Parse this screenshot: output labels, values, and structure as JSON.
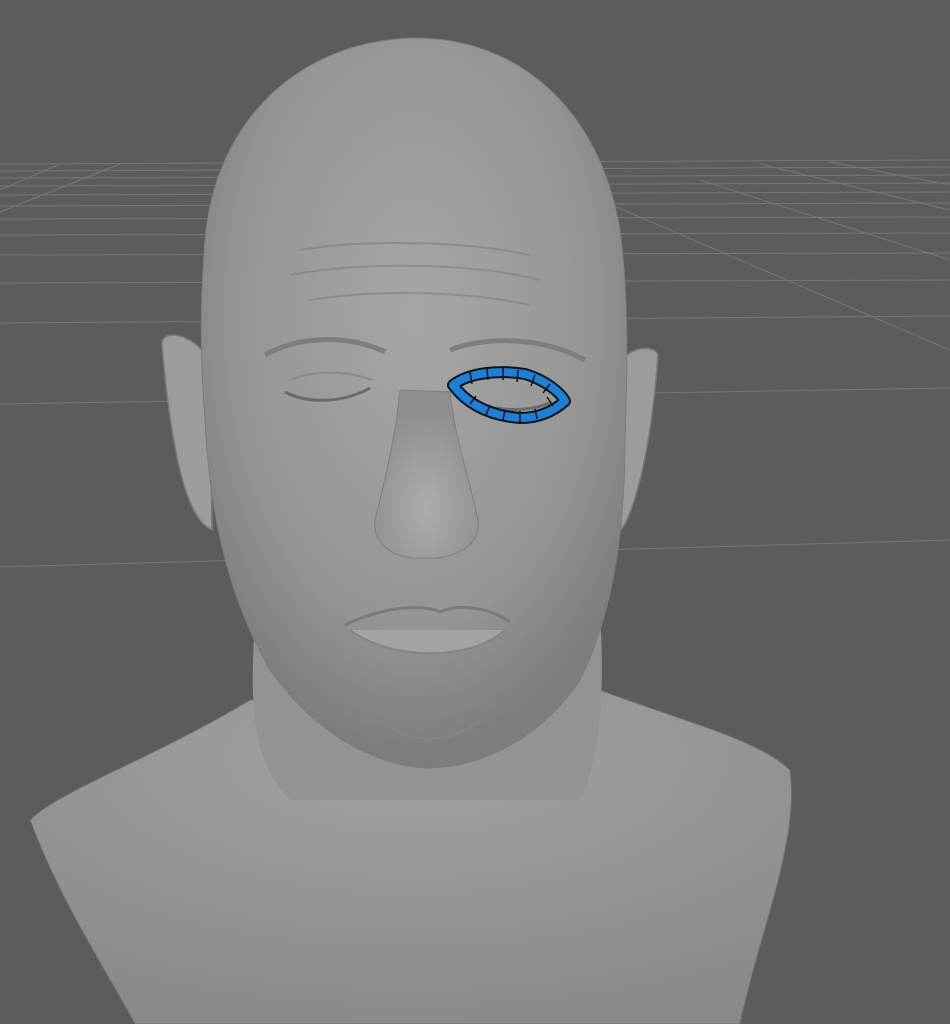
{
  "viewport": {
    "background_color": "#5c5c5c",
    "grid_color": "#767676",
    "model_color": "#9a9a9a",
    "selection_fill": "#1f7fd4",
    "selection_stroke": "#0b1620"
  },
  "scene": {
    "model": "head-bust-mesh",
    "selected_edge_loop": "left-eye-lid-loop",
    "selection_state": "selected"
  }
}
